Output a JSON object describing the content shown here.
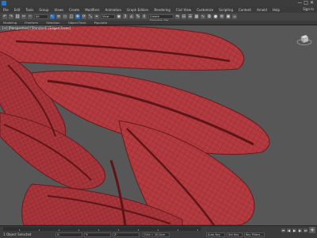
{
  "window": {
    "app_icon": "3dsmax-logo-icon",
    "controls": [
      "—",
      "□",
      "✕"
    ]
  },
  "menu": {
    "items": [
      "File",
      "Edit",
      "Tools",
      "Group",
      "Views",
      "Create",
      "Modifiers",
      "Animation",
      "Graph Editors",
      "Rendering",
      "Civil View",
      "Customize",
      "Scripting",
      "Content",
      "Arnold",
      "Help"
    ],
    "sign_in": "Sign In"
  },
  "toolbar": {
    "filter_select": "All",
    "view_select": "View",
    "selection_set": "Create Selection Set"
  },
  "ribbon": {
    "tabs": [
      "Modeling",
      "Freeform",
      "Selection",
      "Object Paint",
      "Populate"
    ]
  },
  "viewport": {
    "label": "[+] [Perspective] [Standard] [Edged Faces]",
    "leaf_color": "#b33a3f",
    "edge_color": "#7a1f24",
    "background": "#575757"
  },
  "status": {
    "message": "1 Object Selected",
    "x_label": "X:",
    "y_label": "Y:",
    "z_label": "Z:",
    "grid": "Grid = 10,0cm",
    "auto_key": "Auto Key",
    "set_key": "Set Key",
    "selected": "Selected",
    "key_filters": "Key Filters...",
    "frame": "0",
    "frame_range": "0 / 100"
  }
}
